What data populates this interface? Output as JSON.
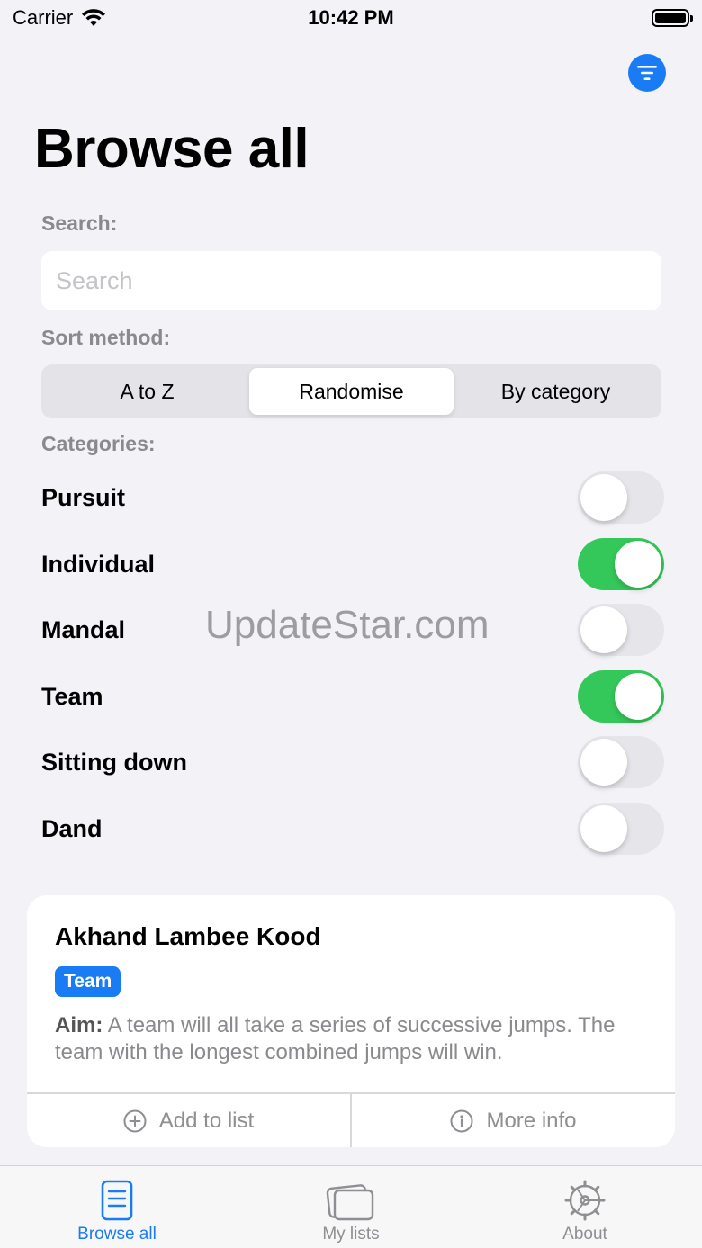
{
  "status": {
    "carrier": "Carrier",
    "time": "10:42 PM"
  },
  "page": {
    "title": "Browse all"
  },
  "search": {
    "label": "Search:",
    "placeholder": "Search",
    "value": ""
  },
  "sort": {
    "label": "Sort method:",
    "options": [
      "A to Z",
      "Randomise",
      "By category"
    ],
    "selected": "Randomise"
  },
  "categories": {
    "label": "Categories:",
    "items": [
      {
        "label": "Pursuit",
        "on": false
      },
      {
        "label": "Individual",
        "on": true
      },
      {
        "label": "Mandal",
        "on": false
      },
      {
        "label": "Team",
        "on": true
      },
      {
        "label": "Sitting down",
        "on": false
      },
      {
        "label": "Dand",
        "on": false
      }
    ]
  },
  "watermark": "UpdateStar.com",
  "card": {
    "title": "Akhand Lambee Kood",
    "tag": "Team",
    "aim_label": "Aim:",
    "aim_text": "A team will all take a series of successive jumps. The team with the longest combined jumps will win.",
    "add_label": "Add to list",
    "info_label": "More info"
  },
  "tabs": [
    {
      "label": "Browse all",
      "icon": "document-icon",
      "active": true
    },
    {
      "label": "My lists",
      "icon": "cards-icon",
      "active": false
    },
    {
      "label": "About",
      "icon": "gear-icon",
      "active": false
    }
  ],
  "colors": {
    "accent": "#1a7cf5",
    "toggle_on": "#34c759",
    "toggle_off": "#e5e5ea",
    "background": "#f2f2f7"
  }
}
